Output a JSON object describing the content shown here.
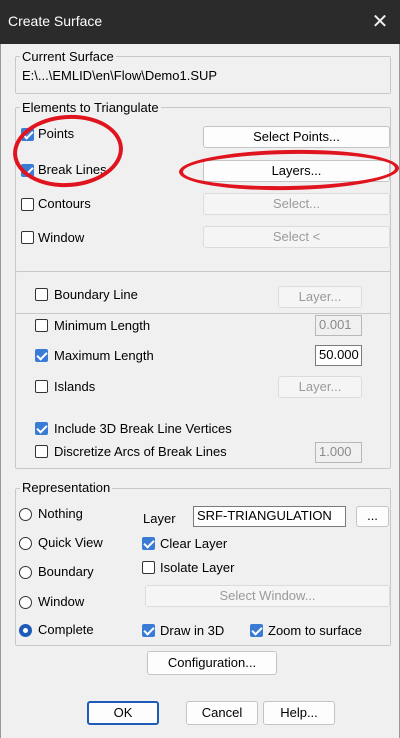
{
  "window": {
    "title": "Create Surface",
    "close_glyph": "✕"
  },
  "current_surface": {
    "legend": "Current Surface",
    "path": "E:\\...\\EMLID\\en\\Flow\\Demo1.SUP"
  },
  "elements": {
    "legend": "Elements to Triangulate",
    "points": {
      "label": "Points",
      "checked": true,
      "button": "Select Points..."
    },
    "break_lines": {
      "label": "Break Lines",
      "checked": true,
      "button": "Layers..."
    },
    "contours": {
      "label": "Contours",
      "checked": false,
      "button": "Select..."
    },
    "window": {
      "label": "Window",
      "checked": false,
      "button": "Select <"
    }
  },
  "options": {
    "boundary_line": {
      "label": "Boundary Line",
      "checked": false,
      "button": "Layer..."
    },
    "minimum_length": {
      "label": "Minimum Length",
      "checked": false,
      "value": "0.001"
    },
    "maximum_length": {
      "label": "Maximum Length",
      "checked": true,
      "value": "50.000"
    },
    "islands": {
      "label": "Islands",
      "checked": false,
      "button": "Layer..."
    },
    "include_3d": {
      "label": "Include 3D Break Line Vertices",
      "checked": true
    },
    "discretize": {
      "label": "Discretize Arcs of Break Lines",
      "checked": false,
      "value": "1.000"
    }
  },
  "representation": {
    "legend": "Representation",
    "nothing": "Nothing",
    "quick_view": "Quick View",
    "boundary": "Boundary",
    "window": "Window",
    "complete": "Complete",
    "selected": "Complete",
    "layer_label": "Layer",
    "layer_value": "SRF-TRIANGULATION",
    "layer_browse": "...",
    "clear_layer": {
      "label": "Clear Layer",
      "checked": true
    },
    "isolate_layer": {
      "label": "Isolate Layer",
      "checked": false
    },
    "select_window": "Select Window...",
    "draw_3d": {
      "label": "Draw in 3D",
      "checked": true
    },
    "zoom_surface": {
      "label": "Zoom to surface",
      "checked": true
    }
  },
  "buttons": {
    "configuration": "Configuration...",
    "ok": "OK",
    "cancel": "Cancel",
    "help": "Help..."
  },
  "colors": {
    "titlebar": "#2b2b2b",
    "accent": "#3a7bd5",
    "annotation": "#e0141e"
  }
}
